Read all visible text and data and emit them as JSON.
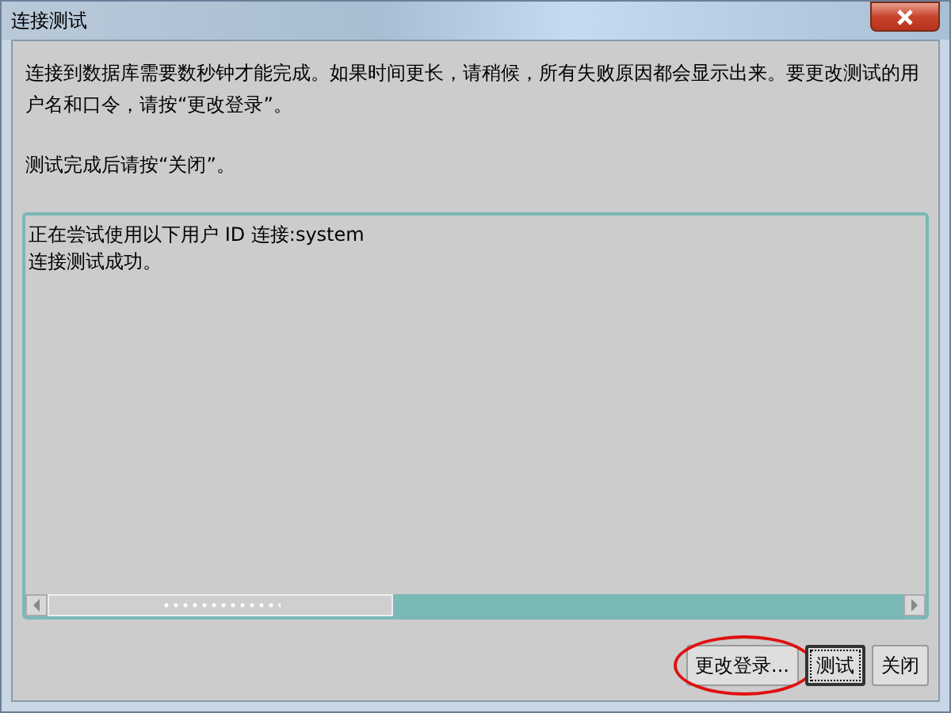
{
  "window": {
    "title": "连接测试"
  },
  "instructions": [
    "连接到数据库需要数秒钟才能完成。如果时间更长，请稍候，所有失败原因都会显示出来。要更改测试的用户名和口令，请按“更改登录”。",
    "测试完成后请按“关闭”。"
  ],
  "output": {
    "lines": [
      "正在尝试使用以下用户 ID 连接:system",
      "连接测试成功。"
    ]
  },
  "buttons": [
    {
      "label": "更改登录...",
      "default": false,
      "circled": true
    },
    {
      "label": "测试",
      "default": true,
      "circled": false
    },
    {
      "label": "关闭",
      "default": false,
      "circled": false
    }
  ]
}
